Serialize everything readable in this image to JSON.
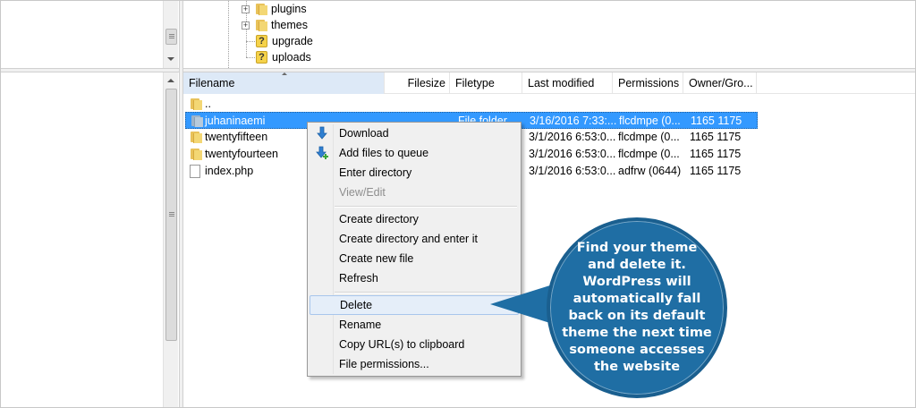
{
  "tree": {
    "items": [
      {
        "label": "plugins",
        "icon": "folder",
        "expandable": true
      },
      {
        "label": "themes",
        "icon": "folder",
        "expandable": true
      },
      {
        "label": "upgrade",
        "icon": "question",
        "expandable": false
      },
      {
        "label": "uploads",
        "icon": "question",
        "expandable": false
      }
    ]
  },
  "columns": {
    "filename": "Filename",
    "filesize": "Filesize",
    "filetype": "Filetype",
    "last_modified": "Last modified",
    "permissions": "Permissions",
    "owner_group": "Owner/Gro..."
  },
  "files": [
    {
      "name": "..",
      "icon": "folder",
      "type": "",
      "modified": "",
      "permissions": "",
      "owner": ""
    },
    {
      "name": "juhaninaemi",
      "icon": "folder-blue",
      "type": "File folder",
      "modified": "3/16/2016 7:33:...",
      "permissions": "flcdmpe (0...",
      "owner": "1165 1175",
      "selected": true
    },
    {
      "name": "twentyfifteen",
      "icon": "folder",
      "type": "",
      "modified": "3/1/2016 6:53:0...",
      "permissions": "flcdmpe (0...",
      "owner": "1165 1175"
    },
    {
      "name": "twentyfourteen",
      "icon": "folder",
      "type": "",
      "modified": "3/1/2016 6:53:0...",
      "permissions": "flcdmpe (0...",
      "owner": "1165 1175"
    },
    {
      "name": "index.php",
      "icon": "file",
      "type": "",
      "modified": "3/1/2016 6:53:0...",
      "permissions": "adfrw (0644)",
      "owner": "1165 1175"
    }
  ],
  "context_menu": {
    "download": "Download",
    "add_to_queue": "Add files to queue",
    "enter_directory": "Enter directory",
    "view_edit": "View/Edit",
    "create_directory": "Create directory",
    "create_directory_enter": "Create directory and enter it",
    "create_new_file": "Create new file",
    "refresh": "Refresh",
    "delete": "Delete",
    "rename": "Rename",
    "copy_urls": "Copy URL(s) to clipboard",
    "file_permissions": "File permissions..."
  },
  "callout": {
    "text": "Find your theme and delete it. WordPress will automatically fall back on its default theme the next time someone accesses the website",
    "color": "#1f6ea4"
  },
  "colors": {
    "selection": "#3399ff",
    "menu_bg": "#f0f0f0",
    "menu_hover": "#e5eef9"
  }
}
